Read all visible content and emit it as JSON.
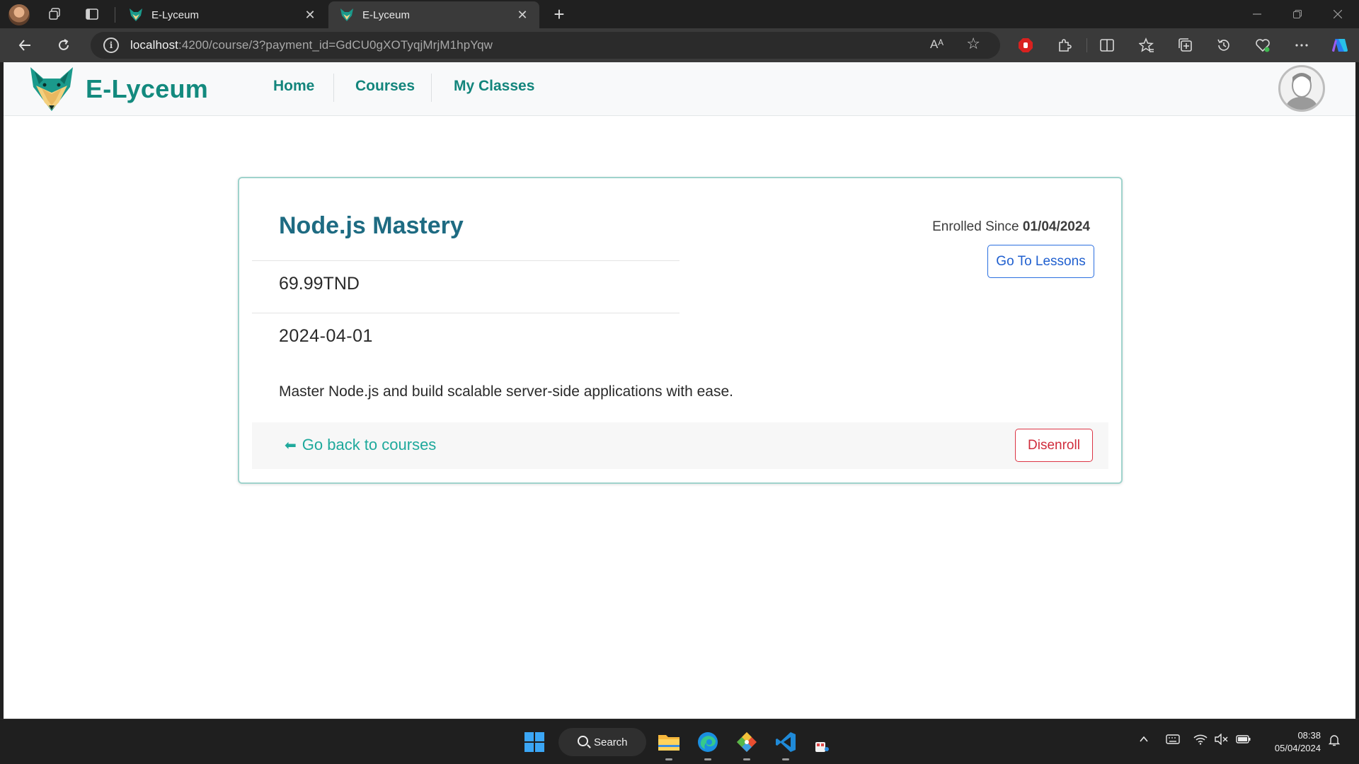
{
  "browser": {
    "tabs": [
      {
        "title": "E-Lyceum",
        "active": false
      },
      {
        "title": "E-Lyceum",
        "active": true
      }
    ],
    "new_tab_symbol": "+",
    "close_symbol": "✕",
    "url_host": "localhost",
    "url_rest": ":4200/course/3?payment_id=GdCU0gXOTyqjMrjM1hpYqw",
    "read_aloud_label": "Aᴬ",
    "icons": [
      "profile-avatar-icon",
      "workspaces-icon",
      "tab-actions-icon",
      "back-icon",
      "refresh-icon",
      "info-icon",
      "read-aloud-icon",
      "favorite-star-icon",
      "adblock-icon",
      "extensions-icon",
      "split-screen-icon",
      "favorites-icon",
      "collections-icon",
      "history-icon",
      "performance-icon",
      "more-icon",
      "copilot-icon"
    ]
  },
  "navbar": {
    "brand_name": "E-Lyceum",
    "links": [
      "Home",
      "Courses",
      "My Classes"
    ],
    "brand_color": "#138a7e"
  },
  "course": {
    "title": "Node.js Mastery",
    "price": "69.99TND",
    "date": "2024-04-01",
    "enrolled_label": "Enrolled Since",
    "enrolled_date": "01/04/2024",
    "go_to_lessons_label": "Go To Lessons",
    "description": "Master Node.js and build scalable server-side applications with ease.",
    "back_label": "Go back to courses",
    "back_arrow": "⬅",
    "disenroll_label": "Disenroll"
  },
  "taskbar": {
    "search_label": "Search",
    "time": "08:38",
    "date": "05/04/2024",
    "apps": [
      "start-icon",
      "file-explorer-icon",
      "edge-icon",
      "git-icon",
      "vscode-icon",
      "snipping-tool-icon"
    ]
  },
  "colors": {
    "accent_teal": "#138a7e",
    "title_blue": "#1e6b82",
    "link_teal": "#1fa99c",
    "primary_blue": "#2a6fe0",
    "danger_red": "#dc3545"
  }
}
